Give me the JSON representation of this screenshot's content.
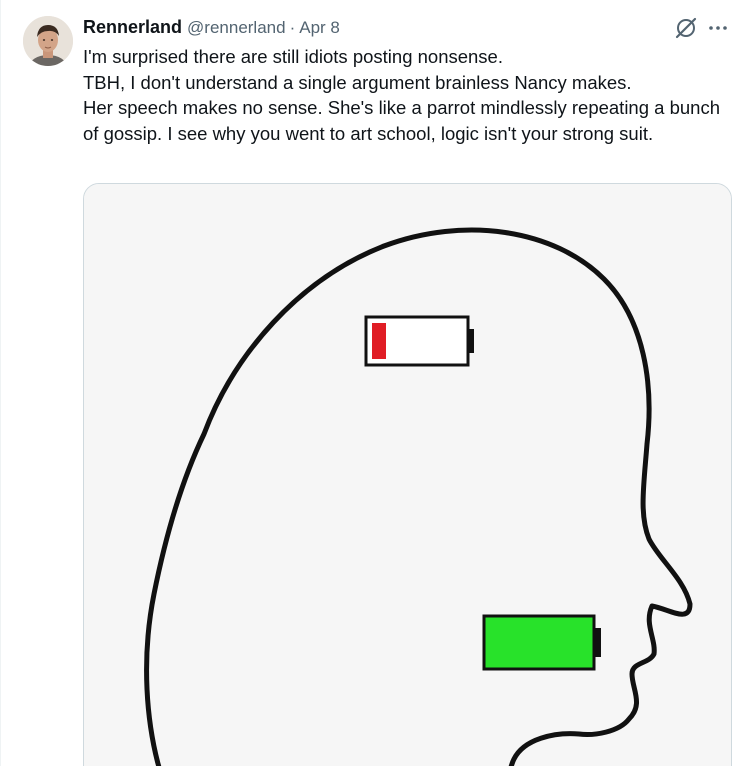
{
  "author": {
    "display_name": "Rennerland",
    "handle": "@rennerland",
    "separator": "·",
    "date": "Apr 8"
  },
  "actions": {
    "grok_icon": "grok-icon",
    "more_icon": "more-icon"
  },
  "tweet_lines": [
    "I'm surprised there are still idiots posting nonsense.",
    "TBH, I don't understand a single argument brainless Nancy makes.",
    "Her speech makes no sense. She's like a parrot mindlessly repeating a bunch of gossip. I see why you went to art school, logic isn't your strong suit."
  ],
  "media": {
    "description_icons": [
      "head-silhouette",
      "low-battery-icon",
      "full-battery-icon"
    ],
    "colors": {
      "low_battery_fill": "#e01d25",
      "full_battery_fill": "#28e22a",
      "outline": "#111111"
    },
    "low_battery_level": 0.15,
    "full_battery_level": 1.0
  }
}
